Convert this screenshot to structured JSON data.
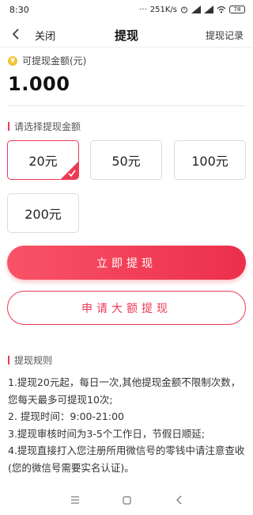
{
  "status_bar": {
    "time": "8:30",
    "network_speed": "251K/s",
    "battery": "78"
  },
  "navbar": {
    "close_label": "关闭",
    "title": "提现",
    "history_label": "提现记录"
  },
  "balance": {
    "label": "可提现金额(元)",
    "coin_symbol": "¥",
    "value": "1.000"
  },
  "amount_section": {
    "title": "请选择提现金额",
    "options": [
      "20元",
      "50元",
      "100元",
      "200元"
    ],
    "selected_index": 0
  },
  "actions": {
    "withdraw_label": "立即提现",
    "large_withdraw_label": "申请大额提现"
  },
  "rules": {
    "title": "提现规则",
    "lines": [
      "1.提现20元起，每日一次,其他提现金额不限制次数，您每天最多可提现10次;",
      "2. 提现时间：9:00-21:00",
      "3.提现审核时间为3-5个工作日，节假日顺延;",
      "4.提现直接打入您注册所用微信号的零钱中请注意查收(您的微信号需要实名认证)。"
    ]
  },
  "colors": {
    "accent": "#ec3a55",
    "coin": "#f2c230"
  }
}
